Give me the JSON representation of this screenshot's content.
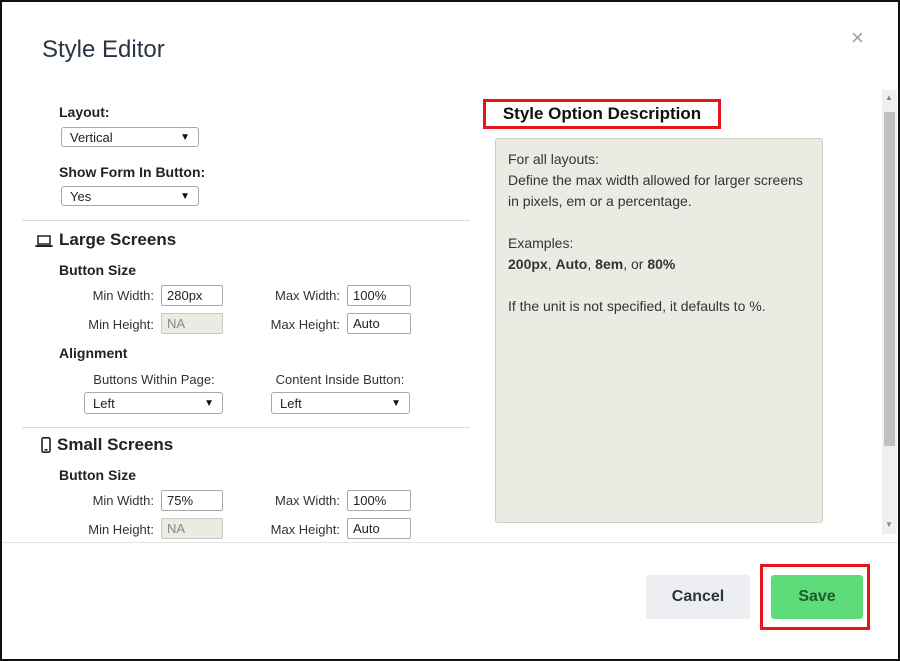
{
  "dialog": {
    "title": "Style Editor",
    "close_glyph": "×"
  },
  "general": {
    "layout_label": "Layout:",
    "layout_value": "Vertical",
    "show_form_label": "Show Form In Button:",
    "show_form_value": "Yes"
  },
  "large": {
    "title": "Large Screens",
    "icon": "laptop-icon",
    "button_size_label": "Button Size",
    "min_width_label": "Min Width:",
    "min_width_value": "280px",
    "max_width_label": "Max Width:",
    "max_width_value": "100%",
    "min_height_label": "Min Height:",
    "min_height_value": "NA",
    "max_height_label": "Max Height:",
    "max_height_value": "Auto",
    "alignment_label": "Alignment",
    "buttons_within_page_label": "Buttons Within Page:",
    "buttons_within_page_value": "Left",
    "content_inside_button_label": "Content Inside Button:",
    "content_inside_button_value": "Left"
  },
  "small": {
    "title": "Small Screens",
    "icon": "mobile-phone-icon",
    "button_size_label": "Button Size",
    "min_width_label": "Min Width:",
    "min_width_value": "75%",
    "max_width_label": "Max Width:",
    "max_width_value": "100%",
    "min_height_label": "Min Height:",
    "min_height_value": "NA",
    "max_height_label": "Max Height:",
    "max_height_value": "Auto"
  },
  "description": {
    "heading": "Style Option Description",
    "line1": "For all layouts:",
    "line2": "Define the max width allowed for larger screens in pixels, em or a percentage.",
    "examples_label": "Examples:",
    "ex1": "200px",
    "sep1": ", ",
    "ex2": "Auto",
    "sep2": ", ",
    "ex3": "8em",
    "sep3": ", or ",
    "ex4": "80%",
    "note": "If the unit is not specified, it defaults to %."
  },
  "footer": {
    "cancel_label": "Cancel",
    "save_label": "Save"
  },
  "colors": {
    "highlight": "#e8141b",
    "save_bg": "#5fdc7a",
    "cancel_bg": "#eceef1",
    "desc_bg": "#ebebe4"
  }
}
